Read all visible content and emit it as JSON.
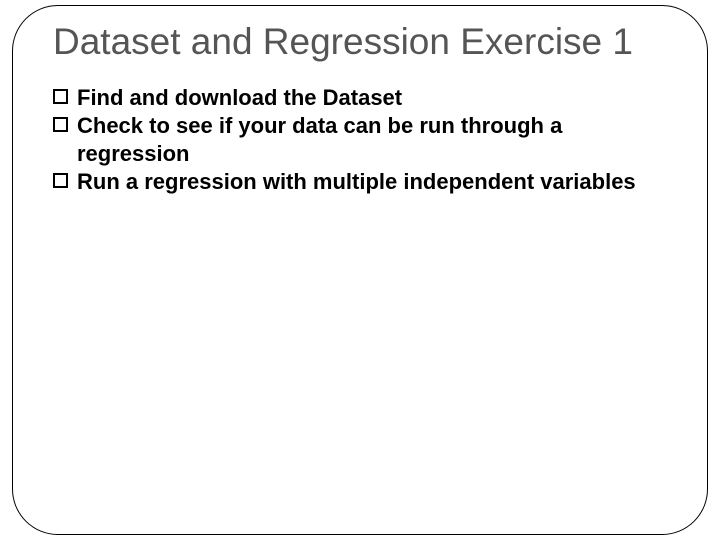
{
  "slide": {
    "title": "Dataset and Regression Exercise 1",
    "bullets": [
      "Find and download the Dataset",
      "Check to see if your data can be run through a regression",
      "Run a regression with multiple independent variables"
    ]
  }
}
